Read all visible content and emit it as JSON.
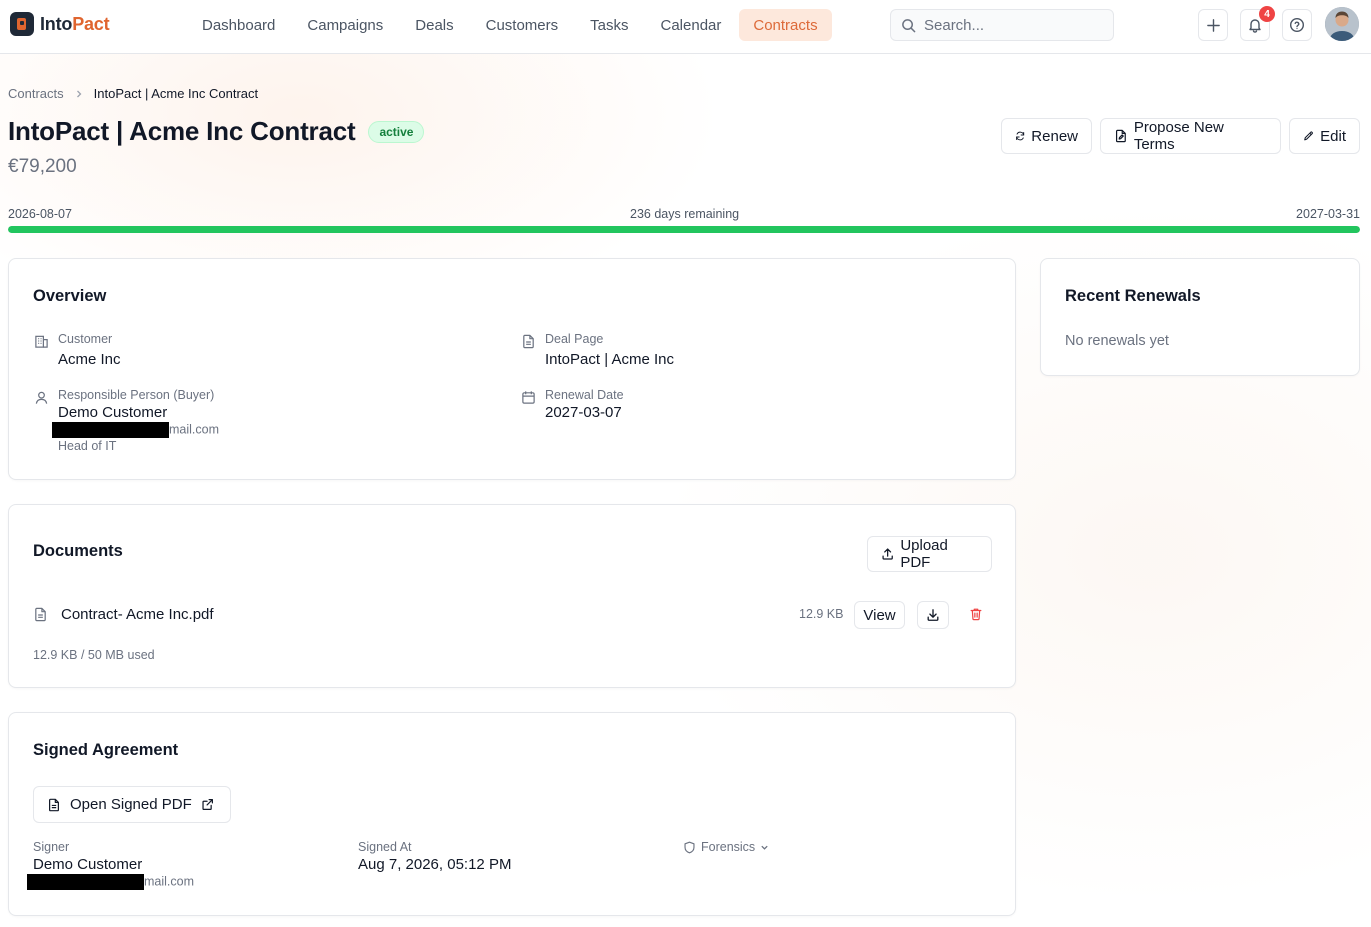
{
  "app": {
    "brand_part1": "Into",
    "brand_part2": "Pact",
    "brand_color": "#e0652f"
  },
  "nav": {
    "items": [
      {
        "label": "Dashboard",
        "active": false
      },
      {
        "label": "Campaigns",
        "active": false
      },
      {
        "label": "Deals",
        "active": false
      },
      {
        "label": "Customers",
        "active": false
      },
      {
        "label": "Tasks",
        "active": false
      },
      {
        "label": "Calendar",
        "active": false
      },
      {
        "label": "Contracts",
        "active": true
      }
    ],
    "search_placeholder": "Search...",
    "notification_count": "4",
    "icons": [
      "plus-icon",
      "bell-icon",
      "help-icon"
    ]
  },
  "breadcrumb": {
    "parent": "Contracts",
    "current": "IntoPact | Acme Inc Contract"
  },
  "header": {
    "title": "IntoPact | Acme Inc Contract",
    "status": "active",
    "amount": "€79,200",
    "actions": {
      "renew": "Renew",
      "propose": "Propose New Terms",
      "edit": "Edit"
    }
  },
  "timeline": {
    "start": "2026-08-07",
    "remaining": "236 days remaining",
    "end": "2027-03-31",
    "progress_percent": 100,
    "progress_color": "#22c55e"
  },
  "overview": {
    "title": "Overview",
    "customer_label": "Customer",
    "customer_value": "Acme Inc",
    "person_label": "Responsible Person (Buyer)",
    "person_name": "Demo Customer",
    "person_email_suffix": "mail.com",
    "person_role": "Head of IT",
    "deal_label": "Deal Page",
    "deal_value": "IntoPact | Acme Inc",
    "renewal_label": "Renewal Date",
    "renewal_value": "2027-03-07"
  },
  "renewals": {
    "title": "Recent Renewals",
    "empty": "No renewals yet"
  },
  "documents": {
    "title": "Documents",
    "upload": "Upload PDF",
    "file_name": "Contract- Acme Inc.pdf",
    "file_size": "12.9 KB",
    "view": "View",
    "usage": "12.9 KB / 50 MB used"
  },
  "signed": {
    "title": "Signed Agreement",
    "open_pdf": "Open Signed PDF",
    "signer_label": "Signer",
    "signer_name": "Demo Customer",
    "signer_email_suffix": "mail.com",
    "signed_at_label": "Signed At",
    "signed_at_value": "Aug 7, 2026, 05:12 PM",
    "forensics": "Forensics"
  }
}
